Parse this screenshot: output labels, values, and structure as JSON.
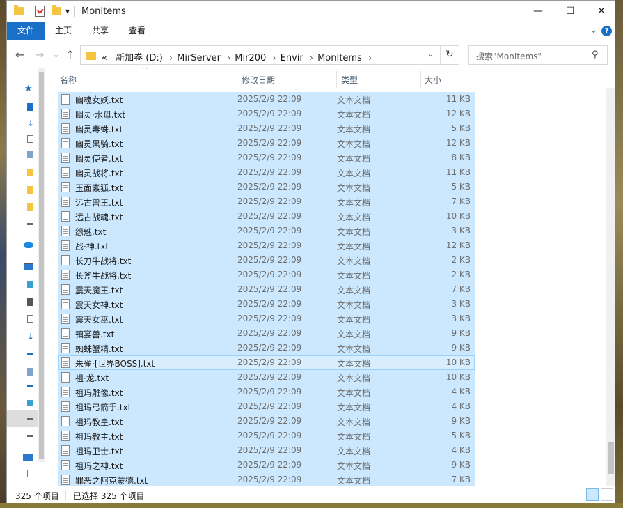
{
  "window": {
    "title": "MonItems",
    "quick_access_dropdown": "▾",
    "controls": {
      "minimize": "—",
      "maximize": "☐",
      "close": "✕"
    }
  },
  "ribbon": {
    "tabs": [
      "文件",
      "主页",
      "共享",
      "查看"
    ],
    "expand": "⌄",
    "help": "?"
  },
  "address_bar": {
    "overflow": "«",
    "crumbs": [
      "新加卷 (D:)",
      "MirServer",
      "Mir200",
      "Envir",
      "MonItems"
    ],
    "refresh": "↻"
  },
  "search": {
    "placeholder": "搜索\"MonItems\""
  },
  "columns": {
    "name": "名称",
    "date": "修改日期",
    "type": "类型",
    "size": "大小"
  },
  "files": [
    {
      "name": "幽魂女妖.txt",
      "date": "2025/2/9 22:09",
      "type": "文本文档",
      "size": "11 KB"
    },
    {
      "name": "幽灵·水母.txt",
      "date": "2025/2/9 22:09",
      "type": "文本文档",
      "size": "12 KB"
    },
    {
      "name": "幽灵毒蛛.txt",
      "date": "2025/2/9 22:09",
      "type": "文本文档",
      "size": "5 KB"
    },
    {
      "name": "幽灵黑骑.txt",
      "date": "2025/2/9 22:09",
      "type": "文本文档",
      "size": "12 KB"
    },
    {
      "name": "幽灵使者.txt",
      "date": "2025/2/9 22:09",
      "type": "文本文档",
      "size": "8 KB"
    },
    {
      "name": "幽灵战将.txt",
      "date": "2025/2/9 22:09",
      "type": "文本文档",
      "size": "11 KB"
    },
    {
      "name": "玉面素狐.txt",
      "date": "2025/2/9 22:09",
      "type": "文本文档",
      "size": "5 KB"
    },
    {
      "name": "远古兽王.txt",
      "date": "2025/2/9 22:09",
      "type": "文本文档",
      "size": "7 KB"
    },
    {
      "name": "远古战魂.txt",
      "date": "2025/2/9 22:09",
      "type": "文本文档",
      "size": "10 KB"
    },
    {
      "name": "怨魅.txt",
      "date": "2025/2/9 22:09",
      "type": "文本文档",
      "size": "3 KB"
    },
    {
      "name": "战·神.txt",
      "date": "2025/2/9 22:09",
      "type": "文本文档",
      "size": "12 KB"
    },
    {
      "name": "长刀牛战将.txt",
      "date": "2025/2/9 22:09",
      "type": "文本文档",
      "size": "2 KB"
    },
    {
      "name": "长斧牛战将.txt",
      "date": "2025/2/9 22:09",
      "type": "文本文档",
      "size": "2 KB"
    },
    {
      "name": "震天魔王.txt",
      "date": "2025/2/9 22:09",
      "type": "文本文档",
      "size": "7 KB"
    },
    {
      "name": "震天女神.txt",
      "date": "2025/2/9 22:09",
      "type": "文本文档",
      "size": "3 KB"
    },
    {
      "name": "震天女巫.txt",
      "date": "2025/2/9 22:09",
      "type": "文本文档",
      "size": "3 KB"
    },
    {
      "name": "镇宴兽.txt",
      "date": "2025/2/9 22:09",
      "type": "文本文档",
      "size": "9 KB"
    },
    {
      "name": "蜘蛛蟹精.txt",
      "date": "2025/2/9 22:09",
      "type": "文本文档",
      "size": "9 KB"
    },
    {
      "name": "朱雀·[世界BOSS].txt",
      "date": "2025/2/9 22:09",
      "type": "文本文档",
      "size": "10 KB"
    },
    {
      "name": "祖·龙.txt",
      "date": "2025/2/9 22:09",
      "type": "文本文档",
      "size": "10 KB"
    },
    {
      "name": "祖玛雕像.txt",
      "date": "2025/2/9 22:09",
      "type": "文本文档",
      "size": "4 KB"
    },
    {
      "name": "祖玛弓箭手.txt",
      "date": "2025/2/9 22:09",
      "type": "文本文档",
      "size": "4 KB"
    },
    {
      "name": "祖玛教皇.txt",
      "date": "2025/2/9 22:09",
      "type": "文本文档",
      "size": "9 KB"
    },
    {
      "name": "祖玛教主.txt",
      "date": "2025/2/9 22:09",
      "type": "文本文档",
      "size": "5 KB"
    },
    {
      "name": "祖玛卫士.txt",
      "date": "2025/2/9 22:09",
      "type": "文本文档",
      "size": "4 KB"
    },
    {
      "name": "祖玛之神.txt",
      "date": "2025/2/9 22:09",
      "type": "文本文档",
      "size": "9 KB"
    },
    {
      "name": "罪恶之阿克蒙德.txt",
      "date": "2025/2/9 22:09",
      "type": "文本文档",
      "size": "7 KB"
    }
  ],
  "focused_row": 18,
  "status": {
    "count": "325 个项目",
    "selected": "已选择 325 个项目"
  },
  "colors": {
    "selection": "#cce8ff",
    "accent": "#1a6fc9",
    "folder": "#f5c542"
  }
}
